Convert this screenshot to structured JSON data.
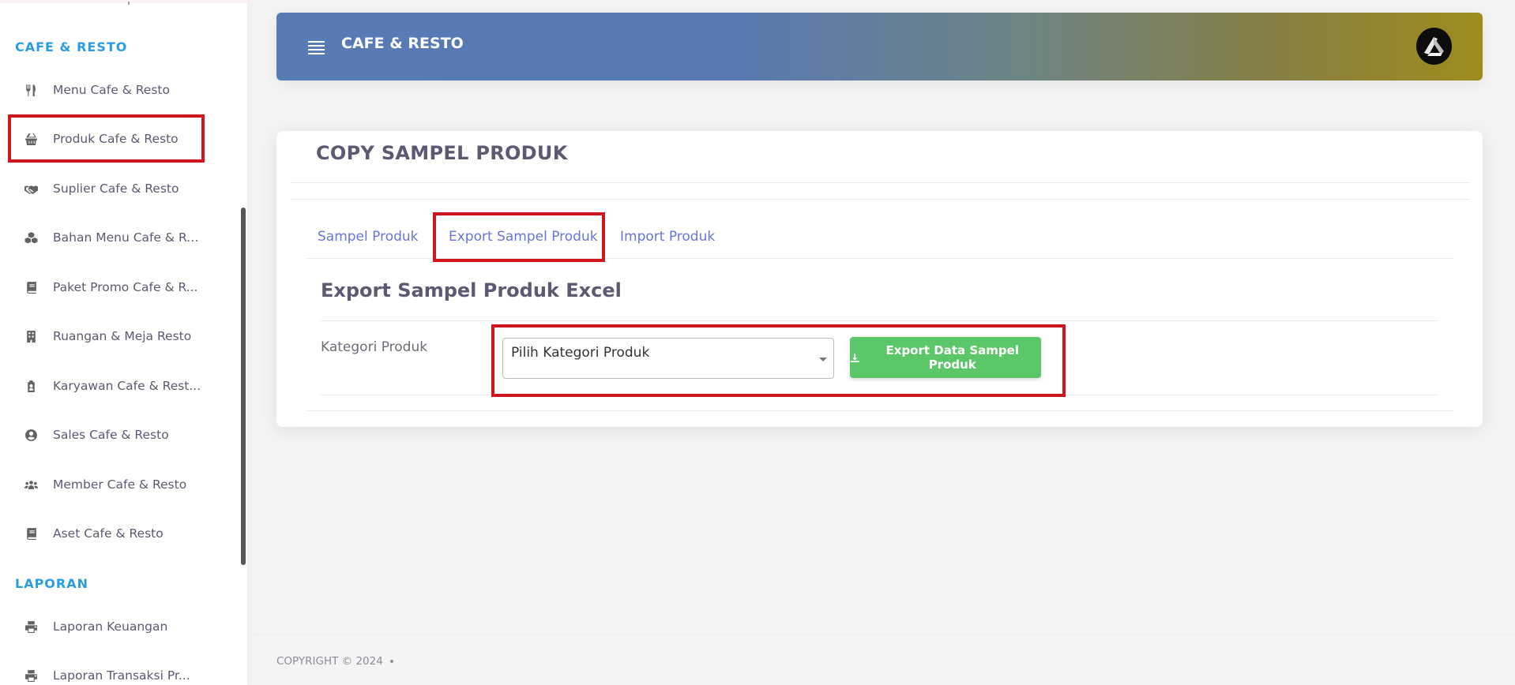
{
  "sidebar": {
    "sections": [
      {
        "header": "CAFE & RESTO",
        "items": [
          {
            "label": "Menu Cafe & Resto",
            "icon": "utensils-icon"
          },
          {
            "label": "Produk Cafe & Resto",
            "icon": "basket-icon"
          },
          {
            "label": "Suplier Cafe & Resto",
            "icon": "handshake-icon"
          },
          {
            "label": "Bahan Menu Cafe & Re...",
            "icon": "cubes-icon"
          },
          {
            "label": "Paket Promo Cafe & R...",
            "icon": "book-icon"
          },
          {
            "label": "Ruangan & Meja Resto",
            "icon": "building-icon"
          },
          {
            "label": "Karyawan Cafe & Rest...",
            "icon": "user-badge-icon"
          },
          {
            "label": "Sales Cafe & Resto",
            "icon": "user-circle-icon"
          },
          {
            "label": "Member Cafe & Resto",
            "icon": "users-icon"
          },
          {
            "label": "Aset Cafe & Resto",
            "icon": "book-icon"
          }
        ]
      },
      {
        "header": "LAPORAN",
        "items": [
          {
            "label": "Laporan Keuangan",
            "icon": "printer-icon"
          },
          {
            "label": "Laporan Transaksi Pr...",
            "icon": "printer-icon"
          }
        ]
      }
    ]
  },
  "header": {
    "title": "CAFE & RESTO",
    "gradient_start": "#587bb6",
    "gradient_end": "#9f8c1d"
  },
  "card": {
    "title": "COPY SAMPEL PRODUK",
    "tabs": [
      {
        "label": "Sampel Produk"
      },
      {
        "label": "Export Sampel Produk"
      },
      {
        "label": "Import Produk"
      }
    ],
    "section_title": "Export Sampel Produk Excel",
    "form": {
      "label": "Kategori Produk",
      "select_value": "Pilih Kategori Produk",
      "button_label": "Export Data Sampel Produk"
    }
  },
  "footer": {
    "copyright": "COPYRIGHT © 2024"
  },
  "colors": {
    "accent": "#2a9de0",
    "tab_link": "#6776d4",
    "button": "#5cc768",
    "highlight": "#d0151c"
  }
}
